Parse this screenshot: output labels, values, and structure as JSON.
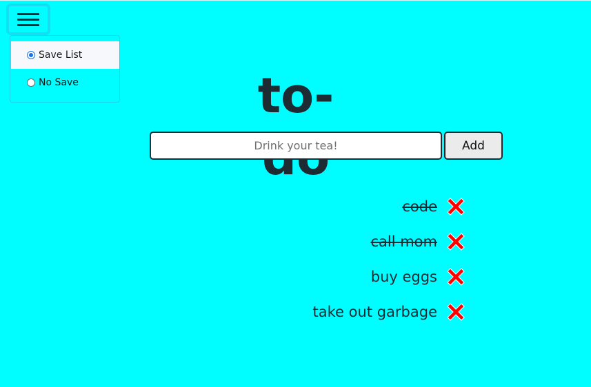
{
  "app": {
    "title": "to-do"
  },
  "menu": {
    "icon": "hamburger-menu-icon",
    "options": [
      {
        "label": "Save List",
        "selected": true
      },
      {
        "label": "No Save",
        "selected": false
      }
    ]
  },
  "form": {
    "input_placeholder": "Drink your tea!",
    "input_value": "",
    "add_label": "Add"
  },
  "todos": [
    {
      "text": "code",
      "done": true
    },
    {
      "text": "call mom",
      "done": true
    },
    {
      "text": "buy eggs",
      "done": false
    },
    {
      "text": "take out garbage",
      "done": false
    }
  ],
  "colors": {
    "background": "#00fdff",
    "text": "#1d2b33",
    "delete_icon": "#ff0000",
    "radio_accent": "#1a73e8"
  },
  "delete_icon": "red-x-icon"
}
